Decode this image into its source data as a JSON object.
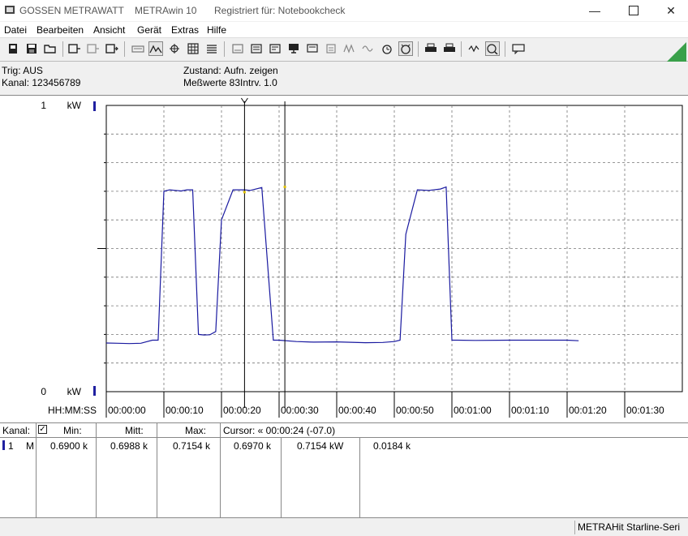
{
  "window": {
    "brand": "GOSSEN METRAWATT",
    "product": "METRAwin 10",
    "registered": "Registriert für: Notebookcheck"
  },
  "menu": [
    "Datei",
    "Bearbeiten",
    "Ansicht",
    "Gerät",
    "Extras",
    "Hilfe"
  ],
  "info": {
    "trig": "Trig: AUS",
    "kanal": "Kanal: 123456789",
    "zustand_label": "Zustand:",
    "zustand_value": "Aufn. zeigen",
    "messwerte": "Meßwerte 83",
    "intrv": "Intrv. 1.0"
  },
  "chart": {
    "y_top_value": "1",
    "y_top_unit": "kW",
    "y_bottom_value": "0",
    "y_bottom_unit": "kW",
    "x_axis_label": "HH:MM:SS"
  },
  "chart_data": {
    "type": "line",
    "x_ticks": [
      "00:00:00",
      "00:00:10",
      "00:00:20",
      "00:00:30",
      "00:00:40",
      "00:00:50",
      "00:01:00",
      "00:01:10",
      "00:01:20",
      "00:01:30"
    ],
    "ylim": [
      0,
      1
    ],
    "grid": true,
    "series": [
      {
        "x": [
          0,
          2,
          4,
          6,
          8,
          9,
          10,
          11,
          12,
          13,
          14,
          15,
          16,
          17,
          18,
          19,
          20,
          22,
          24,
          25,
          27,
          29,
          30,
          33,
          36,
          40,
          45,
          48,
          50,
          51,
          52,
          54,
          56,
          58,
          59,
          60,
          61,
          64,
          70,
          75,
          77,
          80,
          82
        ],
        "y": [
          0.17,
          0.169,
          0.168,
          0.169,
          0.18,
          0.18,
          0.7,
          0.705,
          0.703,
          0.701,
          0.705,
          0.705,
          0.2,
          0.198,
          0.199,
          0.21,
          0.6,
          0.705,
          0.705,
          0.703,
          0.713,
          0.18,
          0.18,
          0.175,
          0.173,
          0.174,
          0.171,
          0.172,
          0.175,
          0.18,
          0.55,
          0.705,
          0.703,
          0.708,
          0.715,
          0.18,
          0.18,
          0.179,
          0.18,
          0.18,
          0.18,
          0.18,
          0.178
        ]
      }
    ],
    "cursors": [
      {
        "x": 24,
        "y": 0.697
      },
      {
        "x": 31,
        "y": 0.7154
      }
    ]
  },
  "panel": {
    "header_kanal": "Kanal:",
    "header_min": "Min:",
    "header_mitt": "Mitt:",
    "header_max": "Max:",
    "header_cursor": "Cursor: « 00:00:24 (-07.0)",
    "row_channel": "1",
    "row_mode": "M",
    "row_min": "0.6900 k",
    "row_mitt": "0.6988 k",
    "row_max": "0.7154 k",
    "row_cursor1": "0.6970 k",
    "row_cursor2": "0.7154 kW",
    "row_diff": "0.0184 k"
  },
  "status": {
    "device": "METRAHit Starline-Seri"
  }
}
